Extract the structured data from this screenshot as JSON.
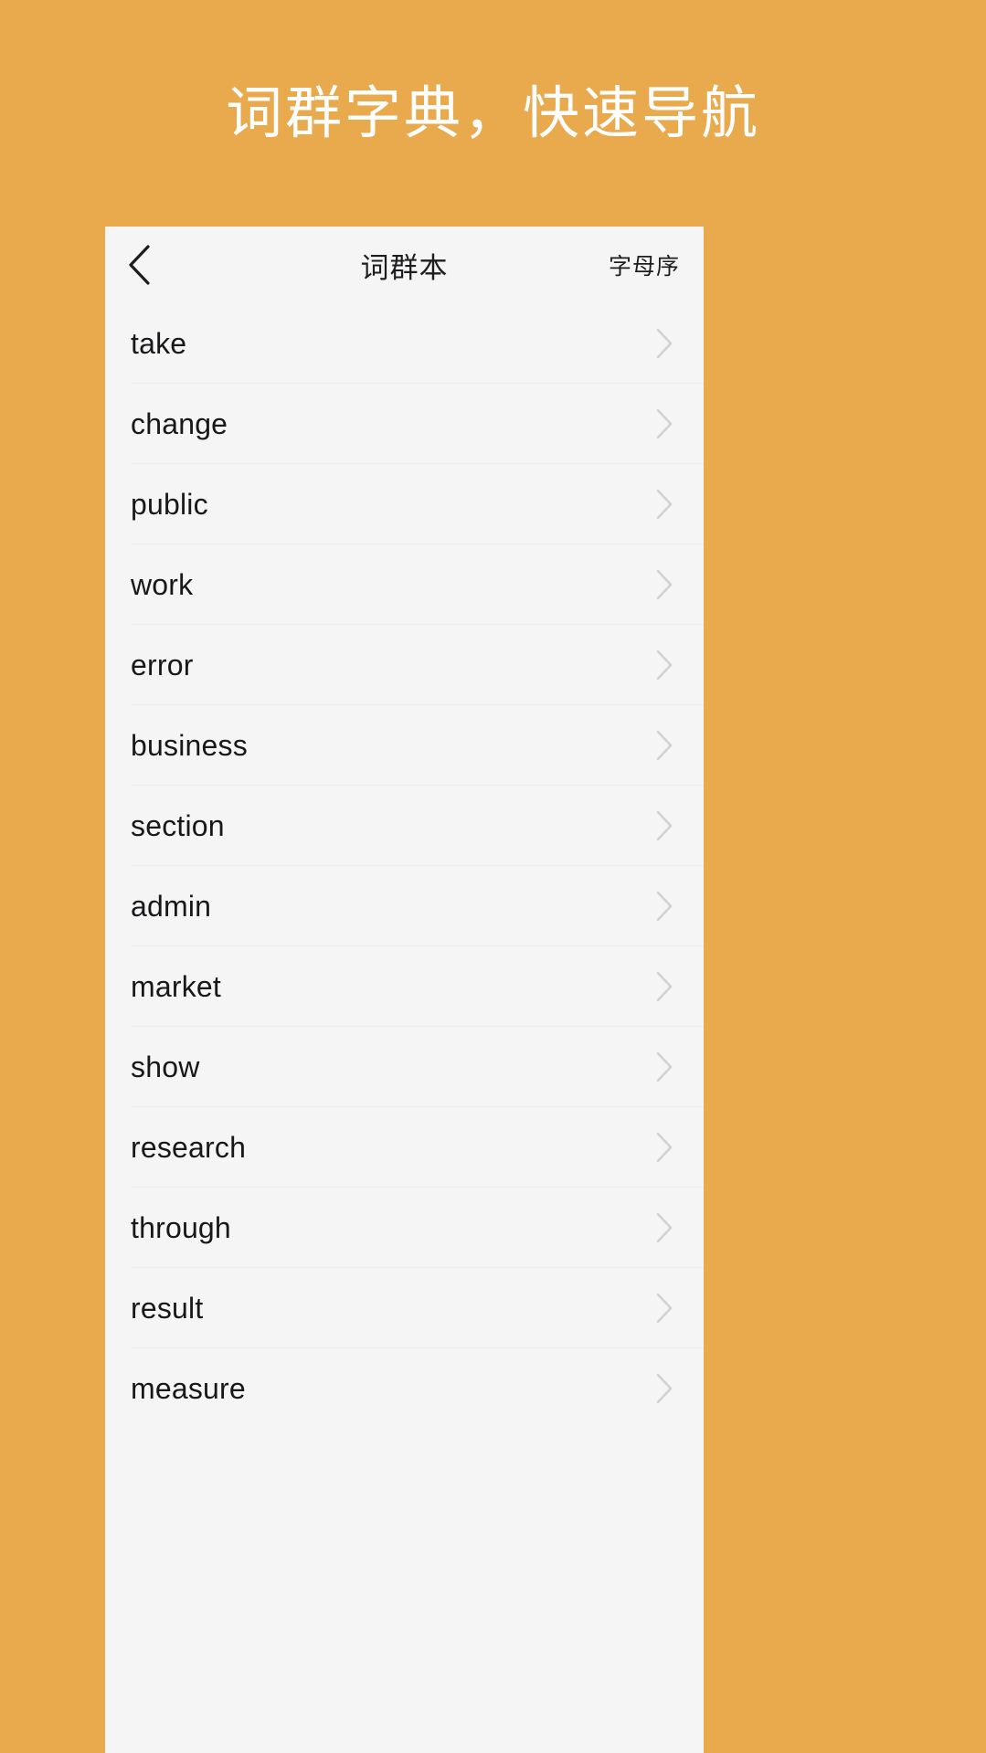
{
  "promo": {
    "headline": "词群字典，快速导航",
    "background_color": "#e9a94d",
    "text_color": "#ffffff"
  },
  "card": {
    "background_color": "#f5f5f6"
  },
  "navbar": {
    "back_icon": "chevron-left-icon",
    "title": "词群本",
    "action_label": "字母序"
  },
  "list": {
    "chevron_icon": "chevron-right-icon",
    "items": [
      {
        "word": "take"
      },
      {
        "word": "change"
      },
      {
        "word": "public"
      },
      {
        "word": "work"
      },
      {
        "word": "error"
      },
      {
        "word": "business"
      },
      {
        "word": "section"
      },
      {
        "word": "admin"
      },
      {
        "word": "market"
      },
      {
        "word": "show"
      },
      {
        "word": "research"
      },
      {
        "word": "through"
      },
      {
        "word": "result"
      },
      {
        "word": "measure"
      }
    ]
  }
}
